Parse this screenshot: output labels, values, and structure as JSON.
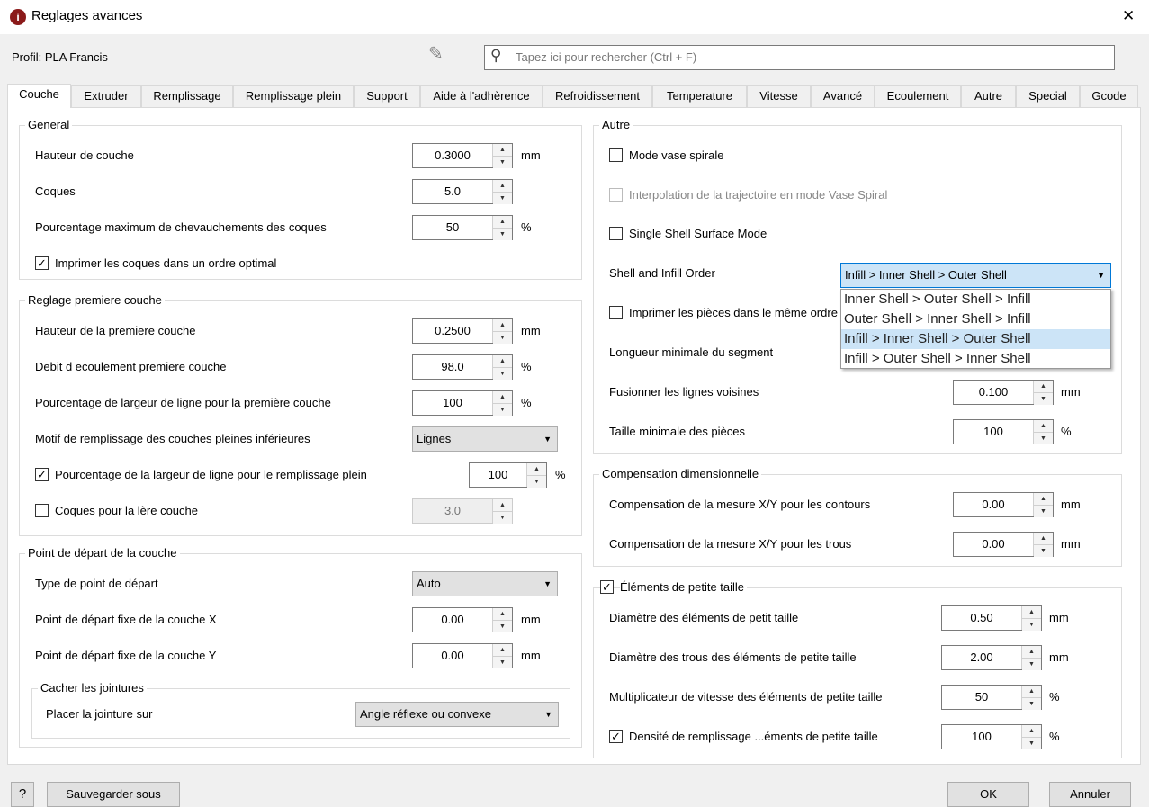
{
  "window": {
    "title": "Reglages avances",
    "close": "✕"
  },
  "profile": "Profil: PLA Francis",
  "search_placeholder": "Tapez ici pour rechercher (Ctrl + F)",
  "tabs": [
    "Couche",
    "Extruder",
    "Remplissage",
    "Remplissage plein",
    "Support",
    "Aide à l'adhèrence",
    "Refroidissement",
    "Temperature",
    "Vitesse",
    "Avancé",
    "Ecoulement",
    "Autre",
    "Special",
    "Gcode"
  ],
  "active_tab": "Couche",
  "general": {
    "title": "General",
    "layer_height": {
      "label": "Hauteur de couche",
      "value": "0.3000",
      "unit": "mm"
    },
    "shells": {
      "label": "Coques",
      "value": "5.0"
    },
    "overlap": {
      "label": "Pourcentage maximum de chevauchements des coques",
      "value": "50",
      "unit": "%"
    },
    "optimal_order": {
      "label": "Imprimer les coques dans un ordre optimal",
      "checked": true
    }
  },
  "first_layer": {
    "title": "Reglage premiere couche",
    "height": {
      "label": "Hauteur de la premiere couche",
      "value": "0.2500",
      "unit": "mm"
    },
    "flow": {
      "label": "Debit d ecoulement premiere couche",
      "value": "98.0",
      "unit": "%"
    },
    "width": {
      "label": "Pourcentage de largeur de ligne pour la première couche",
      "value": "100",
      "unit": "%"
    },
    "pattern": {
      "label": "Motif de remplissage des couches pleines inférieures",
      "value": "Lignes"
    },
    "solid_width": {
      "label": "Pourcentage de la largeur de ligne pour le remplissage plein",
      "value": "100",
      "unit": "%",
      "checked": true
    },
    "first_shells": {
      "label": "Coques pour la lère couche",
      "value": "3.0",
      "checked": false
    }
  },
  "start_point": {
    "title": "Point de départ de la couche",
    "type": {
      "label": "Type de point de départ",
      "value": "Auto"
    },
    "x": {
      "label": "Point de départ fixe de la couche X",
      "value": "0.00",
      "unit": "mm"
    },
    "y": {
      "label": "Point de départ fixe de la couche Y",
      "value": "0.00",
      "unit": "mm"
    },
    "seam": {
      "title": "Cacher les jointures",
      "label": "Placer la jointure sur",
      "value": "Angle réflexe ou convexe"
    }
  },
  "other": {
    "title": "Autre",
    "vase": {
      "label": "Mode vase spirale",
      "checked": false
    },
    "vase_interp": {
      "label": "Interpolation de la trajectoire en mode Vase Spiral",
      "checked": false,
      "disabled": true
    },
    "single_shell": {
      "label": "Single Shell Surface Mode",
      "checked": false
    },
    "order": {
      "label": "Shell and Infill Order",
      "value": "Infill > Inner Shell > Outer Shell",
      "options": [
        "Inner Shell > Outer Shell > Infill",
        "Outer Shell > Inner Shell > Infill",
        "Infill > Inner Shell > Outer Shell",
        "Infill > Outer Shell > Inner Shell"
      ]
    },
    "same_order": {
      "label": "Imprimer les pièces dans le même ordre",
      "checked": false
    },
    "min_segment": {
      "label": "Longueur minimale du segment"
    },
    "merge": {
      "label": "Fusionner les lignes voisines",
      "value": "0.100",
      "unit": "mm"
    },
    "min_size": {
      "label": "Taille minimale des pièces",
      "value": "100",
      "unit": "%"
    }
  },
  "compensation": {
    "title": "Compensation dimensionnelle",
    "outer": {
      "label": "Compensation de la mesure X/Y pour les contours",
      "value": "0.00",
      "unit": "mm"
    },
    "holes": {
      "label": "Compensation de la mesure X/Y pour les trous",
      "value": "0.00",
      "unit": "mm"
    }
  },
  "small": {
    "title": "Éléments de petite taille",
    "checked": true,
    "diameter": {
      "label": "Diamètre des éléments de petit taille",
      "value": "0.50",
      "unit": "mm"
    },
    "hole_diameter": {
      "label": "Diamètre des trous des éléments de petite taille",
      "value": "2.00",
      "unit": "mm"
    },
    "speed": {
      "label": "Multiplicateur de vitesse des éléments de petite taille",
      "value": "50",
      "unit": "%"
    },
    "density": {
      "label": "Densité de remplissage ...éments de petite taille",
      "value": "100",
      "unit": "%",
      "checked": true
    }
  },
  "footer": {
    "help": "?",
    "save_as": "Sauvegarder sous",
    "ok": "OK",
    "cancel": "Annuler"
  }
}
